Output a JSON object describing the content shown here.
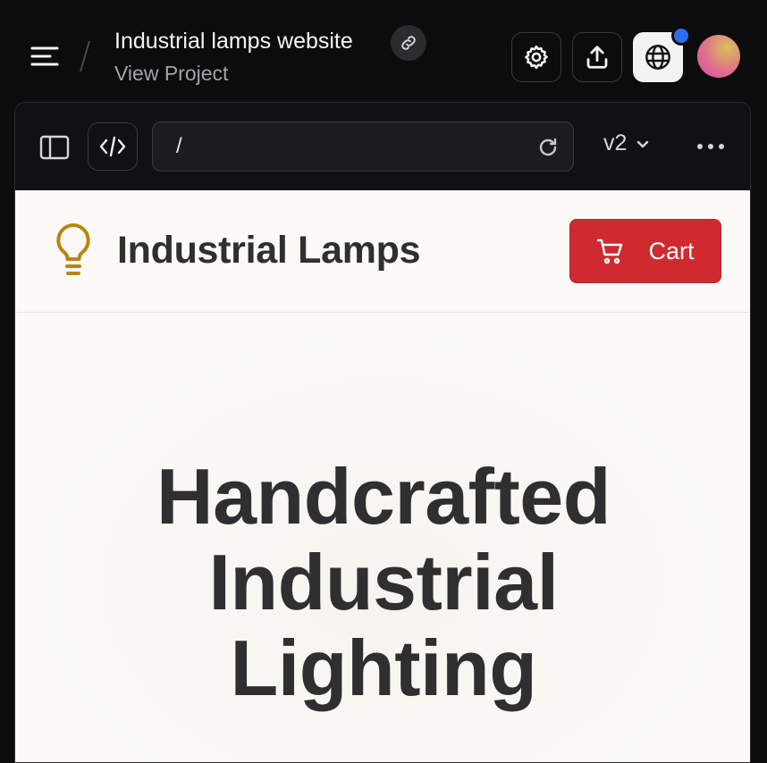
{
  "topbar": {
    "project_title": "Industrial lamps website",
    "project_subtitle": "View Project",
    "icons": [
      "menu-icon",
      "link-icon",
      "gear-icon",
      "share-icon",
      "globe-icon"
    ],
    "notification_color": "#2f6cf0"
  },
  "browser": {
    "url": "/",
    "version": "v2",
    "icons": [
      "sidebar-toggle-icon",
      "code-icon",
      "reload-icon",
      "chevron-down-icon",
      "more-icon"
    ]
  },
  "site": {
    "brand": "Industrial Lamps",
    "cart_label": "Cart",
    "accent_color": "#cf2a2f",
    "bulb_color": "#b8860b",
    "hero_lines": [
      "Handcrafted",
      "Industrial",
      "Lighting"
    ]
  }
}
